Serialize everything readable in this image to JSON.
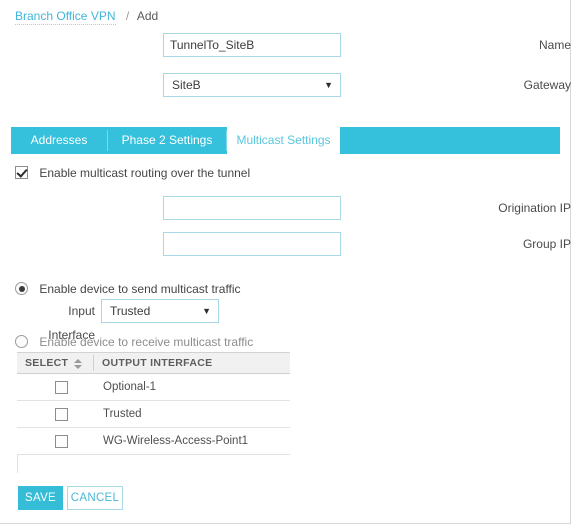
{
  "breadcrumb": {
    "link": "Branch Office VPN",
    "separator": "/",
    "current": "Add"
  },
  "form": {
    "name_label": "Name",
    "name_value": "TunnelTo_SiteB",
    "gateway_label": "Gateway",
    "gateway_value": "SiteB",
    "dropdown_arrow": "▼"
  },
  "tabs": [
    {
      "label": "Addresses",
      "active": false
    },
    {
      "label": "Phase 2 Settings",
      "active": false
    },
    {
      "label": "Multicast Settings",
      "active": true
    }
  ],
  "multicast": {
    "enable_label": "Enable multicast routing over the tunnel",
    "enable_checked": true,
    "origination_ip_label": "Origination IP",
    "origination_ip_value": "",
    "group_ip_label": "Group IP",
    "group_ip_value": "",
    "send_radio_label": "Enable device to send multicast traffic",
    "send_radio_selected": true,
    "input_interface_label": "Input Interface",
    "input_interface_value": "Trusted",
    "receive_radio_label": "Enable device to receive multicast traffic",
    "receive_radio_selected": false
  },
  "table": {
    "columns": [
      "SELECT",
      "OUTPUT INTERFACE"
    ],
    "sort_column": "SELECT",
    "rows": [
      {
        "selected": false,
        "output_interface": "Optional-1"
      },
      {
        "selected": false,
        "output_interface": "Trusted"
      },
      {
        "selected": false,
        "output_interface": "WG-Wireless-Access-Point1"
      }
    ]
  },
  "buttons": {
    "save": "SAVE",
    "cancel": "CANCEL"
  },
  "colors": {
    "accent": "#35c0dc",
    "link": "#41b6d9",
    "save_bg": "#35bdd8"
  }
}
